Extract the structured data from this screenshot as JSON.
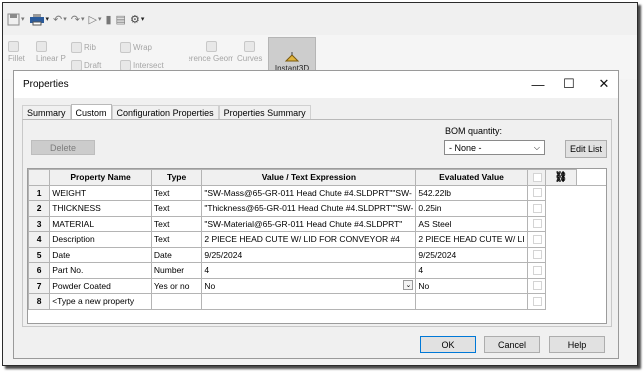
{
  "toolbar": {
    "ribbon_items": [
      "Fillet",
      "Linear Pattern",
      "Rib",
      "Draft",
      "Wrap",
      "Intersect",
      "Reference Geometry",
      "Curves"
    ],
    "instant3d_label": "Instant3D"
  },
  "dialog": {
    "title": "Properties",
    "tabs": [
      "Summary",
      "Custom",
      "Configuration Properties",
      "Properties Summary"
    ],
    "active_tab": "Custom",
    "delete_label": "Delete",
    "bom_label": "BOM quantity:",
    "bom_value": "- None -",
    "edit_list_label": "Edit List",
    "ok_label": "OK",
    "cancel_label": "Cancel",
    "help_label": "Help"
  },
  "grid": {
    "headers": [
      "Property Name",
      "Type",
      "Value / Text Expression",
      "Evaluated Value"
    ],
    "rows": [
      {
        "num": "1",
        "name": "WEIGHT",
        "type": "Text",
        "value": "\"SW-Mass@65-GR-011 Head Chute #4.SLDPRT\"\"SW-",
        "evaluated": "542.22lb"
      },
      {
        "num": "2",
        "name": "THICKNESS",
        "type": "Text",
        "value": "\"Thickness@65-GR-011 Head Chute #4.SLDPRT\"\"SW-",
        "evaluated": "0.25in"
      },
      {
        "num": "3",
        "name": "MATERIAL",
        "type": "Text",
        "value": "\"SW-Material@65-GR-011 Head Chute #4.SLDPRT\"",
        "evaluated": "AS Steel"
      },
      {
        "num": "4",
        "name": "Description",
        "type": "Text",
        "value": "2 PIECE HEAD CUTE W/ LID FOR CONVEYOR #4",
        "evaluated": "2 PIECE HEAD CUTE W/ LI"
      },
      {
        "num": "5",
        "name": "Date",
        "type": "Date",
        "value": "9/25/2024",
        "evaluated": "9/25/2024"
      },
      {
        "num": "6",
        "name": "Part No.",
        "type": "Number",
        "value": "4",
        "evaluated": "4"
      },
      {
        "num": "7",
        "name": "Powder Coated",
        "type": "Yes or no",
        "value": "No",
        "evaluated": "No"
      },
      {
        "num": "8",
        "name": "<Type a new property",
        "type": "",
        "value": "",
        "evaluated": ""
      }
    ]
  }
}
